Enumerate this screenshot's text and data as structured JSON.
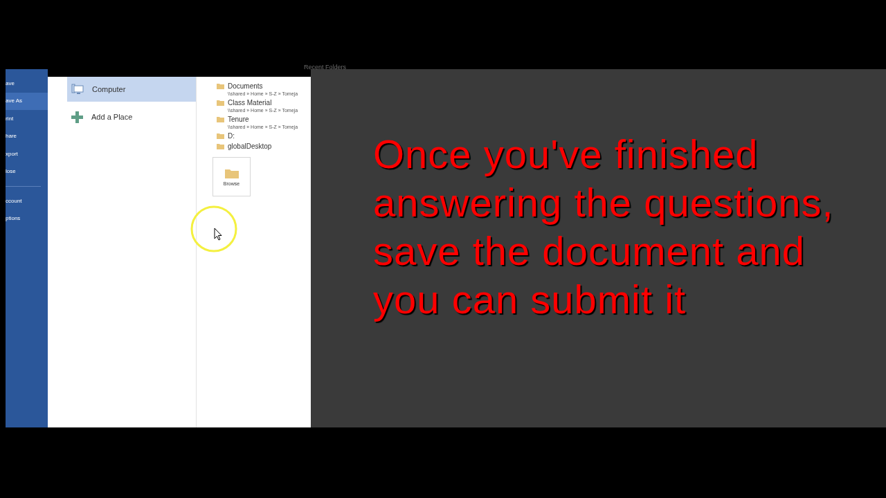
{
  "sidebar": {
    "items": [
      {
        "label": "ave",
        "selected": false
      },
      {
        "label": "ave As",
        "selected": true
      },
      {
        "label": "rint",
        "selected": false
      },
      {
        "label": "hare",
        "selected": false
      },
      {
        "label": "xport",
        "selected": false
      },
      {
        "label": "lose",
        "selected": false
      }
    ],
    "bottom_items": [
      {
        "label": "ccount",
        "selected": false
      },
      {
        "label": "ptions",
        "selected": false
      }
    ]
  },
  "places": [
    {
      "label": "Computer",
      "kind": "computer",
      "selected": true
    },
    {
      "label": "Add a Place",
      "kind": "add",
      "selected": false
    }
  ],
  "recent_folders": {
    "title": "Recent Folders",
    "items": [
      {
        "name": "Documents",
        "path": "\\\\shared » Home » S-Z » Tomeja"
      },
      {
        "name": "Class Material",
        "path": "\\\\shared » Home » S-Z » Tomeja"
      },
      {
        "name": "Tenure",
        "path": "\\\\shared » Home » S-Z » Tomeja"
      },
      {
        "name": "D:"
      },
      {
        "name": "globalDesktop"
      }
    ],
    "browse": "Browse"
  },
  "caption": "Once you've finished\nanswering the questions,\nsave the document and\nyou can submit it"
}
